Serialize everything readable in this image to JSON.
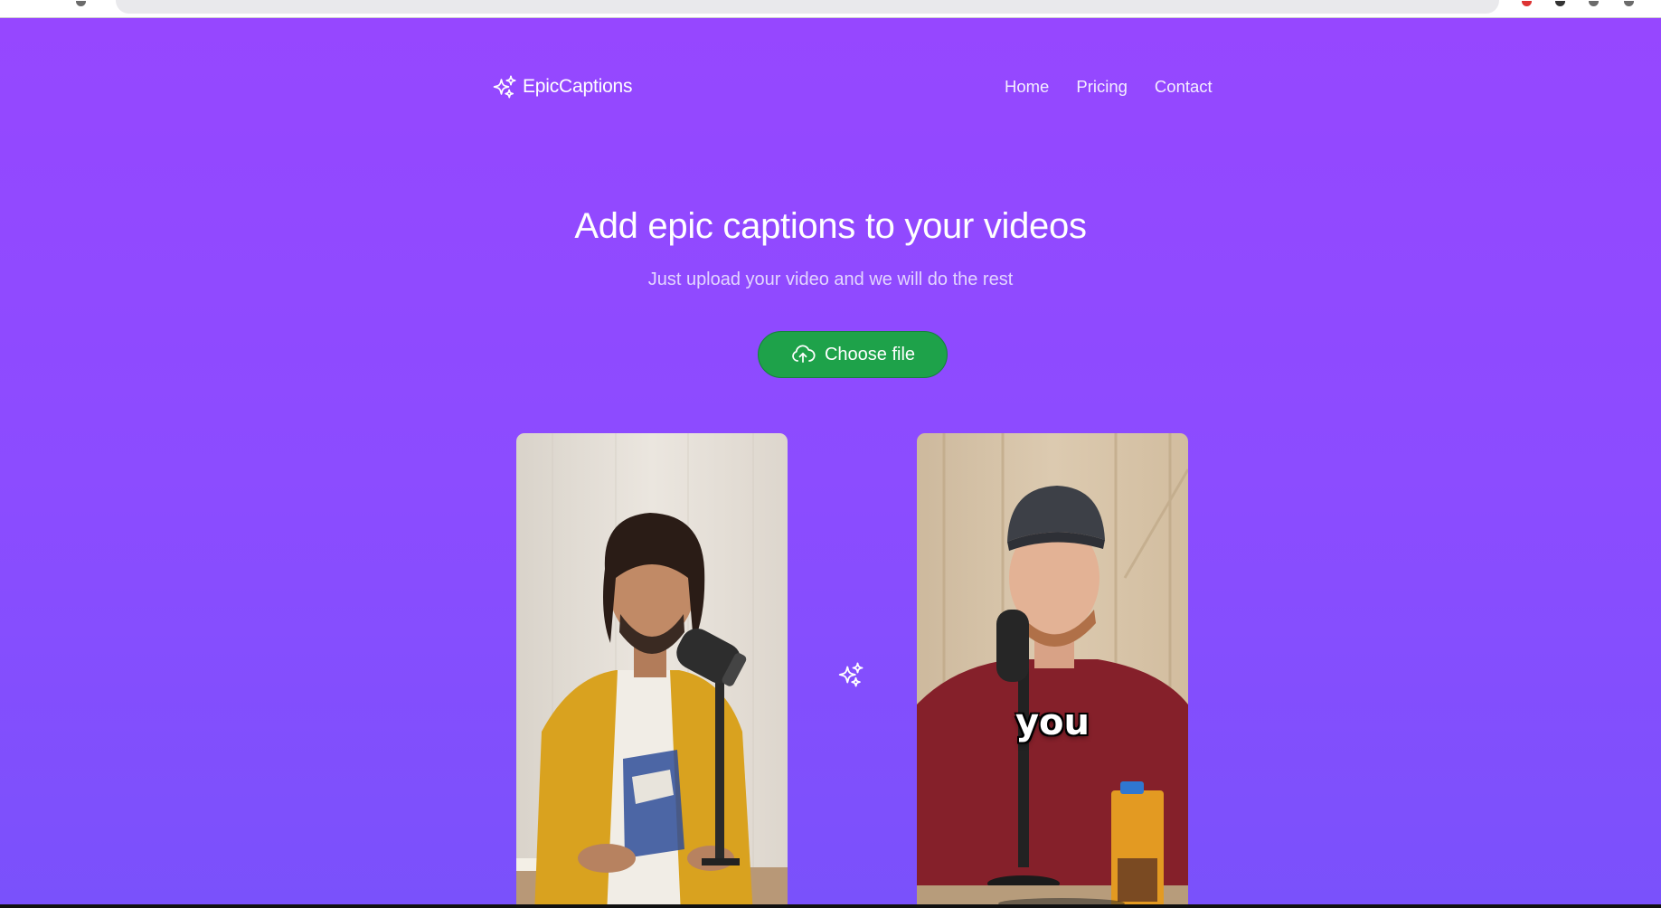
{
  "brand": {
    "name": "EpicCaptions",
    "icon": "sparkles-icon",
    "background_top": "#9647ff",
    "background_bottom": "#7a51fb",
    "accent_button": "#1ea24a"
  },
  "nav": {
    "items": [
      {
        "label": "Home"
      },
      {
        "label": "Pricing"
      },
      {
        "label": "Contact"
      }
    ]
  },
  "hero": {
    "title": "Add epic captions to your videos",
    "subtitle": "Just upload your video and we will do the rest",
    "upload_button": {
      "label": "Choose file",
      "icon": "cloud-upload-icon"
    }
  },
  "demo": {
    "before_video": {
      "alt": "original video"
    },
    "after_video": {
      "caption": "you"
    },
    "transform_icon": "sparkles-icon"
  }
}
